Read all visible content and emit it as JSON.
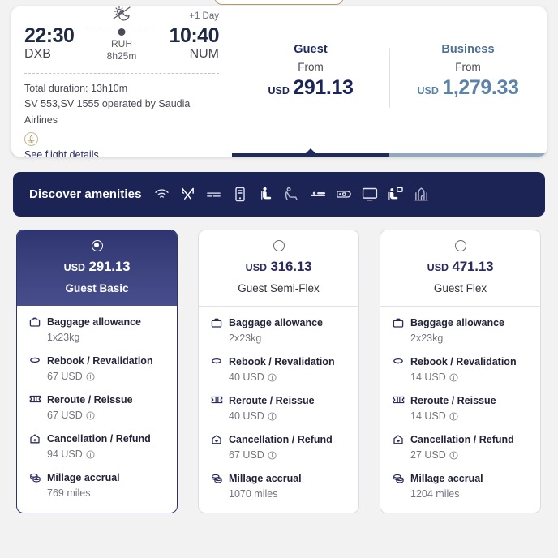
{
  "flight": {
    "depart_time": "22:30",
    "depart_code": "DXB",
    "arrive_time": "10:40",
    "arrive_code": "NUM",
    "plus_day": "+1 Day",
    "stop_code": "RUH",
    "stop_duration": "8h25m",
    "total_duration": "Total duration: 13h10m",
    "operated_by": "SV 553,SV 1555 operated by Saudia Airlines",
    "details_link": "See flight details"
  },
  "cabins": [
    {
      "name": "Guest",
      "from_label": "From",
      "currency": "USD",
      "amount": "291.13",
      "active": true
    },
    {
      "name": "Business",
      "from_label": "From",
      "currency": "USD",
      "amount": "1,279.33",
      "active": false
    }
  ],
  "amenities": {
    "title": "Discover amenities",
    "icons": [
      "wifi-icon",
      "dining-icon",
      "power-outlet-icon",
      "tablet-icon",
      "seat-upright-icon",
      "seat-recline-icon",
      "lie-flat-bed-icon",
      "usb-port-icon",
      "entertainment-screen-icon",
      "seat-with-screen-icon",
      "prayer-room-icon"
    ]
  },
  "fares": [
    {
      "selected": true,
      "currency": "USD",
      "amount": "291.13",
      "name": "Guest Basic",
      "features": [
        {
          "icon": "baggage-icon",
          "label": "Baggage allowance",
          "value": "1x23kg",
          "info": false
        },
        {
          "icon": "rebook-icon",
          "label": "Rebook / Revalidation",
          "value": "67 USD",
          "info": true
        },
        {
          "icon": "reroute-ticket-icon",
          "label": "Reroute / Reissue",
          "value": "67 USD",
          "info": true
        },
        {
          "icon": "cancellation-icon",
          "label": "Cancellation / Refund",
          "value": "94 USD",
          "info": true
        },
        {
          "icon": "miles-coins-icon",
          "label": "Millage accrual",
          "value": "769 miles",
          "info": false
        }
      ]
    },
    {
      "selected": false,
      "currency": "USD",
      "amount": "316.13",
      "name": "Guest Semi-Flex",
      "features": [
        {
          "icon": "baggage-icon",
          "label": "Baggage allowance",
          "value": "2x23kg",
          "info": false
        },
        {
          "icon": "rebook-icon",
          "label": "Rebook / Revalidation",
          "value": "40 USD",
          "info": true
        },
        {
          "icon": "reroute-ticket-icon",
          "label": "Reroute / Reissue",
          "value": "40 USD",
          "info": true
        },
        {
          "icon": "cancellation-icon",
          "label": "Cancellation / Refund",
          "value": "67 USD",
          "info": true
        },
        {
          "icon": "miles-coins-icon",
          "label": "Millage accrual",
          "value": "1070 miles",
          "info": false
        }
      ]
    },
    {
      "selected": false,
      "currency": "USD",
      "amount": "471.13",
      "name": "Guest Flex",
      "features": [
        {
          "icon": "baggage-icon",
          "label": "Baggage allowance",
          "value": "2x23kg",
          "info": false
        },
        {
          "icon": "rebook-icon",
          "label": "Rebook / Revalidation",
          "value": "14 USD",
          "info": true
        },
        {
          "icon": "reroute-ticket-icon",
          "label": "Reroute / Reissue",
          "value": "14 USD",
          "info": true
        },
        {
          "icon": "cancellation-icon",
          "label": "Cancellation / Refund",
          "value": "27 USD",
          "info": true
        },
        {
          "icon": "miles-coins-icon",
          "label": "Millage accrual",
          "value": "1204 miles",
          "info": false
        }
      ]
    }
  ],
  "colors": {
    "navy": "#1c2455",
    "accent_selected": "#2e3570",
    "inactive_tab": "#5b82a8",
    "page_bg": "#f2f2f2"
  }
}
